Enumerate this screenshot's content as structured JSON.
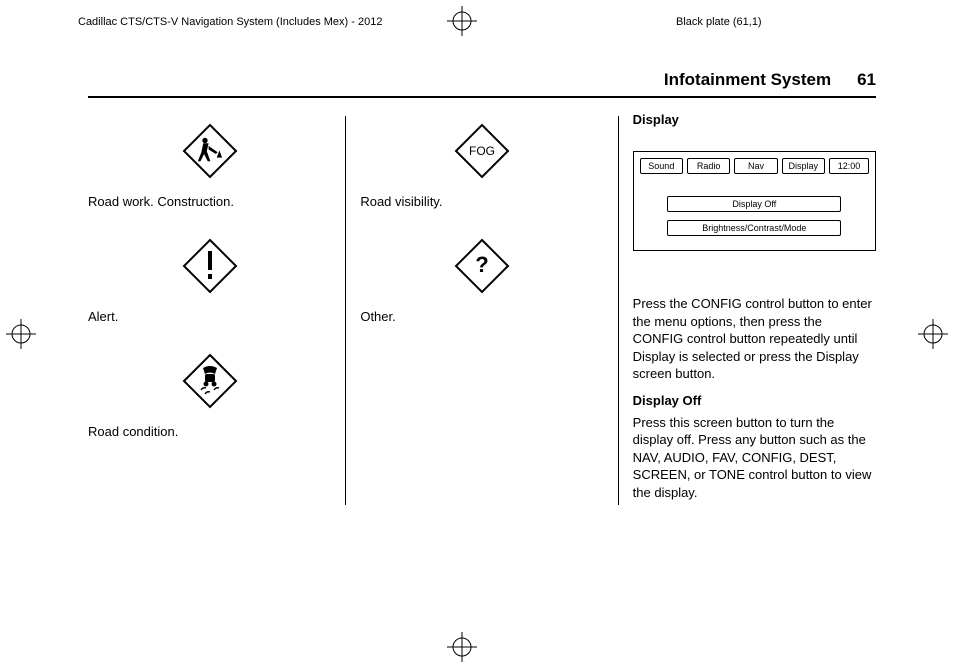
{
  "meta": {
    "doc_title": "Cadillac CTS/CTS-V Navigation System (Includes Mex) - 2012",
    "plate": "Black plate (61,1)"
  },
  "header": {
    "title": "Infotainment System",
    "page": "61"
  },
  "col1": {
    "road_work": "Road work. Construction.",
    "alert": "Alert.",
    "road_condition": "Road condition."
  },
  "col2": {
    "road_visibility": "Road visibility.",
    "other": "Other.",
    "fog_label": "FOG"
  },
  "col3": {
    "display_heading": "Display",
    "screen": {
      "tabs": [
        "Sound",
        "Radio",
        "Nav",
        "Display"
      ],
      "clock": "12:00",
      "menu": [
        "Display Off",
        "Brightness/Contrast/Mode"
      ]
    },
    "paragraph1": "Press the CONFIG control button to enter the menu options, then press the CONFIG control button repeatedly until Display is selected or press the Display screen button.",
    "sub_heading": "Display Off",
    "paragraph2": "Press this screen button to turn the display off. Press any button such as the NAV, AUDIO, FAV, CONFIG, DEST, SCREEN, or TONE control button to view the display."
  }
}
